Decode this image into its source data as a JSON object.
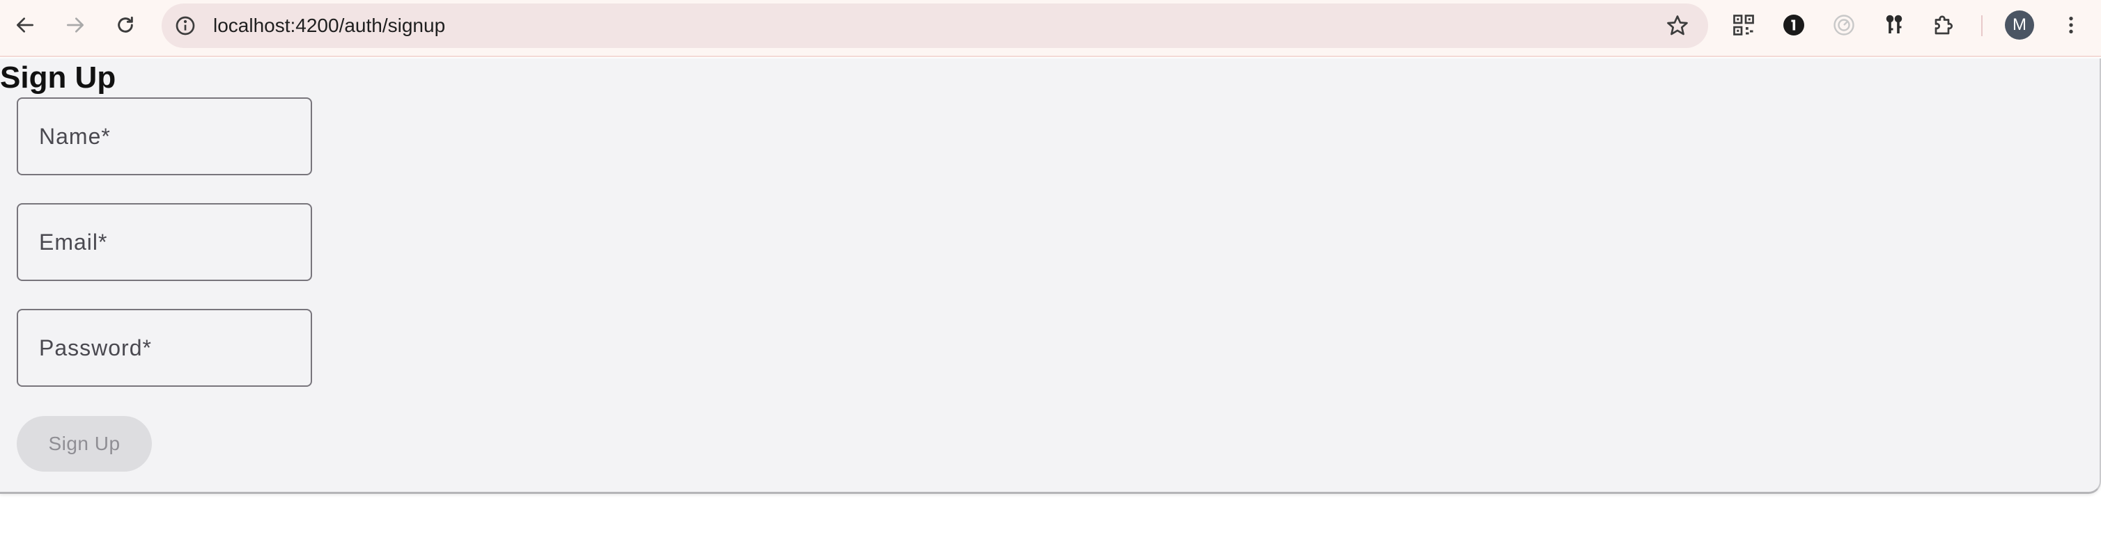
{
  "browser": {
    "url": "localhost:4200/auth/signup",
    "avatar_initial": "M",
    "icons": {
      "back": "arrow-left-icon",
      "forward": "arrow-right-icon",
      "reload": "reload-icon",
      "site_info": "info-icon",
      "bookmark": "star-icon",
      "qr": "qr-code-icon",
      "password_manager": "password-manager-icon",
      "dial": "dial-icon",
      "keys": "keys-icon",
      "extensions": "puzzle-icon",
      "menu": "more-vert-icon"
    }
  },
  "page": {
    "title": "Sign Up",
    "form": {
      "name_placeholder": "Name*",
      "name_value": "",
      "email_placeholder": "Email*",
      "email_value": "",
      "password_placeholder": "Password*",
      "password_value": "",
      "submit_label": "Sign Up",
      "submit_disabled": true
    }
  },
  "colors": {
    "toolbar_bg": "#fdf6f3",
    "omnibox_bg": "#f2e4e4",
    "page_bg": "#f3f3f5",
    "field_border": "#78757c",
    "button_disabled_bg": "#dddde0",
    "button_disabled_text": "#8f8e94"
  }
}
